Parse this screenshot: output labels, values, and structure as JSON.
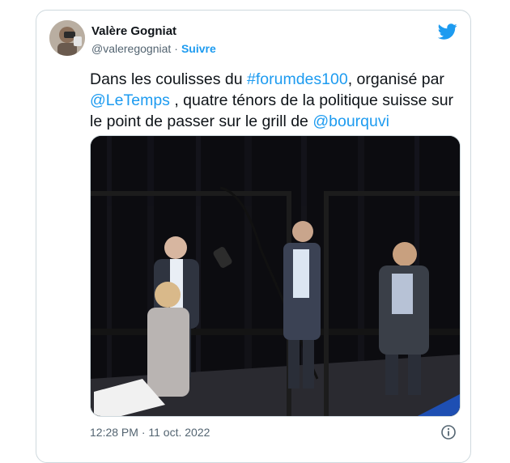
{
  "tweet": {
    "author_name": "Valère Gogniat",
    "author_handle": "@valeregogniat",
    "separator": "·",
    "follow_label": "Suivre",
    "text_parts": {
      "p1": "Dans les coulisses du ",
      "hashtag": "#forumdes100",
      "p2": ", organisé par ",
      "mention1": "@LeTemps",
      "p3": " , quatre ténors de la politique suisse sur le point de passer sur le grill de ",
      "mention2": "@bourquvi"
    },
    "timestamp": "12:28 PM · 11 oct. 2022"
  },
  "icons": {
    "brand": "twitter-bird-icon",
    "info": "info-circle-icon"
  },
  "colors": {
    "accent": "#1d9bf0",
    "text": "#0f1419",
    "secondary": "#536471",
    "border": "#cfd9de"
  }
}
